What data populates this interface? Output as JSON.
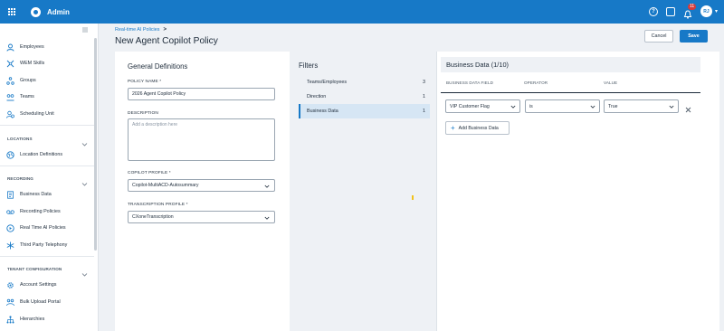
{
  "topbar": {
    "app_title": "Admin",
    "notification_count": "11",
    "user_initials": "RJ",
    "help_icon": "help-icon",
    "apps_icon": "apps-icon"
  },
  "sidebar": {
    "items_top": [
      {
        "label": "Employees",
        "icon": "person-icon"
      },
      {
        "label": "WEM Skills",
        "icon": "skills-icon"
      },
      {
        "label": "Groups",
        "icon": "groups-icon"
      },
      {
        "label": "Teams",
        "icon": "teams-icon"
      },
      {
        "label": "Scheduling Unit",
        "icon": "scheduling-icon"
      }
    ],
    "section_locations": "LOCATIONS",
    "location_definitions": "Location Definitions",
    "section_recording": "RECORDING",
    "recording_items": [
      {
        "label": "Business Data",
        "icon": "business-data-icon"
      },
      {
        "label": "Recording Policies",
        "icon": "recording-icon"
      },
      {
        "label": "Real Time AI Policies",
        "icon": "play-icon"
      },
      {
        "label": "Third Party Telephony",
        "icon": "telephony-icon"
      }
    ],
    "section_tenant": "TENANT CONFIGURATION",
    "tenant_items": [
      {
        "label": "Account Settings",
        "icon": "gear-icon"
      },
      {
        "label": "Bulk Upload Portal",
        "icon": "upload-icon"
      },
      {
        "label": "Hierarchies",
        "icon": "hierarchy-icon"
      }
    ]
  },
  "header": {
    "breadcrumb": "Real-time AI Policies",
    "breadcrumb_sep": ">",
    "title": "New Agent Copilot Policy",
    "cancel_label": "Cancel",
    "save_label": "Save"
  },
  "general": {
    "title": "General Definitions",
    "policy_name_label": "POLICY NAME",
    "policy_name_value": "2026 Agent Copilot Policy",
    "description_label": "DESCRIPTION",
    "description_placeholder": "Add a description here",
    "copilot_profile_label": "COPILOT PROFILE",
    "copilot_profile_value": "Copilot-MultiACD-Autosummary",
    "transcription_profile_label": "TRANSCRIPTION PROFILE",
    "transcription_profile_value": "CXoneTranscription",
    "required_mark": "*"
  },
  "filters": {
    "title": "Filters",
    "items": [
      {
        "label": "Teams/Employees",
        "count": "3"
      },
      {
        "label": "Direction",
        "count": "1"
      },
      {
        "label": "Business Data",
        "count": "1"
      }
    ],
    "selected_index": 2
  },
  "business_data": {
    "title": "Business Data (1/10)",
    "col_field": "BUSINESS DATA FIELD",
    "col_operator": "OPERATOR",
    "col_value": "VALUE",
    "row": {
      "field": "VIP Customer Flag",
      "operator": "is",
      "value": "True"
    },
    "add_label": "Add Business Data"
  },
  "colors": {
    "accent": "#1779c7",
    "selected_bg": "#d6e6f4"
  }
}
